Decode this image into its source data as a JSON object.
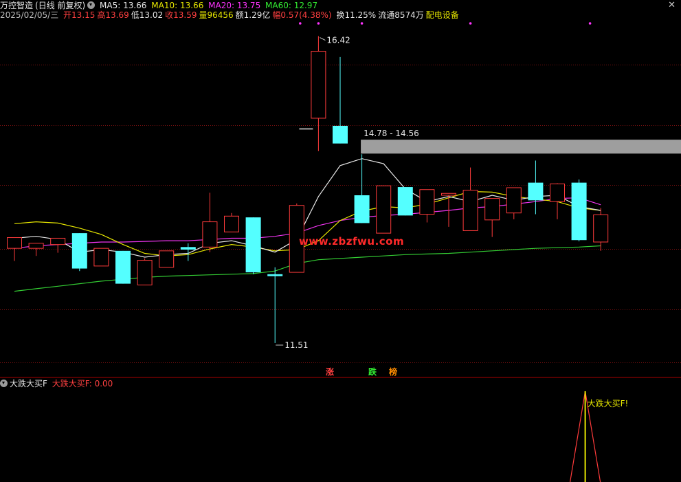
{
  "header": {
    "stock_name": "万控智造",
    "period": "(日线 前复权)",
    "ma5": "MA5: 13.66",
    "ma10": "MA10: 13.66",
    "ma20": "MA20: 13.75",
    "ma60": "MA60: 12.97",
    "date": "2025/02/05/三",
    "open": "开13.15",
    "high": "高13.69",
    "low": "低13.02",
    "close": "收13.59",
    "volume": "量96456",
    "amount": "额1.29亿",
    "change": "幅0.57(4.38%)",
    "turnover": "换11.25%",
    "float": "流通8574万",
    "sector": "配电设备"
  },
  "annotations": {
    "high_label": "16.42",
    "low_label": "11.51",
    "zone_label": "14.78 - 14.56",
    "watermark": "www.zbzfwu.com",
    "tag_up": "涨",
    "tag_down": "跌",
    "tag_rank": "榜"
  },
  "sub_header": {
    "title": "大跌大买F",
    "value": "大跌大买F: 0.00",
    "signal_label": "大跌大买F!"
  },
  "colors": {
    "up": "#ff3b3b",
    "down": "#54ffff",
    "ma5": "#e8e8e8",
    "ma10": "#e6e600",
    "ma20": "#ee33ee",
    "ma60": "#33cc33",
    "zone": "#9e9e9e",
    "signal": "#e6e600"
  },
  "chart_data": {
    "type": "candlestick",
    "ylim": [
      11.2,
      16.6
    ],
    "resistance_zone": [
      14.56,
      14.78
    ],
    "candles": [
      {
        "o": 13.06,
        "h": 13.18,
        "l": 12.86,
        "c": 13.23
      },
      {
        "o": 13.06,
        "h": 13.08,
        "l": 12.94,
        "c": 13.14
      },
      {
        "o": 13.12,
        "h": 13.22,
        "l": 12.99,
        "c": 13.22
      },
      {
        "o": 13.3,
        "h": 13.3,
        "l": 12.7,
        "c": 12.74
      },
      {
        "o": 12.78,
        "h": 13.06,
        "l": 12.78,
        "c": 13.06
      },
      {
        "o": 13.02,
        "h": 13.02,
        "l": 12.5,
        "c": 12.5
      },
      {
        "o": 12.48,
        "h": 12.9,
        "l": 12.48,
        "c": 12.87
      },
      {
        "o": 12.76,
        "h": 13.02,
        "l": 12.76,
        "c": 13.02
      },
      {
        "o": 13.08,
        "h": 13.14,
        "l": 12.86,
        "c": 13.04
      },
      {
        "o": 13.08,
        "h": 13.94,
        "l": 13.0,
        "c": 13.48
      },
      {
        "o": 13.32,
        "h": 13.62,
        "l": 13.32,
        "c": 13.57
      },
      {
        "o": 13.55,
        "h": 13.55,
        "l": 12.65,
        "c": 12.68
      },
      {
        "o": 12.65,
        "h": 12.76,
        "l": 11.56,
        "c": 12.62
      },
      {
        "o": 12.68,
        "h": 13.77,
        "l": 12.68,
        "c": 13.74
      },
      {
        "o": 15.12,
        "h": 16.42,
        "l": 14.6,
        "c": 16.18
      },
      {
        "o": 15.0,
        "h": 16.09,
        "l": 14.72,
        "c": 14.72
      },
      {
        "o": 13.9,
        "h": 14.55,
        "l": 13.46,
        "c": 13.46
      },
      {
        "o": 13.3,
        "h": 14.05,
        "l": 13.3,
        "c": 14.05
      },
      {
        "o": 14.03,
        "h": 14.03,
        "l": 13.58,
        "c": 13.58
      },
      {
        "o": 13.6,
        "h": 13.98,
        "l": 13.47,
        "c": 13.99
      },
      {
        "o": 13.9,
        "h": 13.9,
        "l": 13.4,
        "c": 13.93
      },
      {
        "o": 13.34,
        "h": 14.34,
        "l": 13.34,
        "c": 13.98
      },
      {
        "o": 13.51,
        "h": 13.51,
        "l": 13.24,
        "c": 13.85
      },
      {
        "o": 13.62,
        "h": 14.02,
        "l": 13.52,
        "c": 14.02
      },
      {
        "o": 14.1,
        "h": 14.45,
        "l": 13.6,
        "c": 13.82
      },
      {
        "o": 13.8,
        "h": 14.09,
        "l": 13.52,
        "c": 14.08
      },
      {
        "o": 14.1,
        "h": 14.15,
        "l": 13.17,
        "c": 13.19
      },
      {
        "o": 13.16,
        "h": 13.7,
        "l": 13.02,
        "c": 13.59
      }
    ],
    "ma5": [
      13.22,
      13.25,
      13.2,
      13.0,
      13.04,
      13.0,
      12.92,
      12.96,
      12.98,
      13.14,
      13.18,
      13.1,
      13.0,
      13.2,
      13.88,
      14.37,
      14.48,
      14.4,
      14.0,
      13.8,
      13.88,
      13.8,
      13.9,
      13.82,
      13.88,
      13.9,
      13.72,
      13.66
    ],
    "ma10": [
      13.45,
      13.48,
      13.46,
      13.38,
      13.28,
      13.12,
      12.98,
      12.94,
      12.96,
      13.05,
      13.12,
      13.08,
      13.02,
      13.04,
      13.18,
      13.5,
      13.65,
      13.72,
      13.7,
      13.76,
      13.86,
      13.96,
      13.95,
      13.88,
      13.84,
      13.8,
      13.7,
      13.66
    ],
    "ma20": [
      13.06,
      13.1,
      13.12,
      13.14,
      13.16,
      13.16,
      13.17,
      13.18,
      13.18,
      13.2,
      13.22,
      13.22,
      13.25,
      13.3,
      13.42,
      13.5,
      13.55,
      13.58,
      13.6,
      13.63,
      13.66,
      13.7,
      13.72,
      13.76,
      13.8,
      13.85,
      13.86,
      13.75
    ],
    "ma60": [
      12.38,
      12.42,
      12.46,
      12.5,
      12.54,
      12.57,
      12.6,
      12.62,
      12.63,
      12.64,
      12.65,
      12.66,
      12.7,
      12.82,
      12.88,
      12.9,
      12.92,
      12.94,
      12.96,
      12.97,
      12.98,
      13.0,
      13.02,
      13.04,
      13.06,
      13.07,
      13.08,
      13.1
    ],
    "signal_index": 26
  }
}
